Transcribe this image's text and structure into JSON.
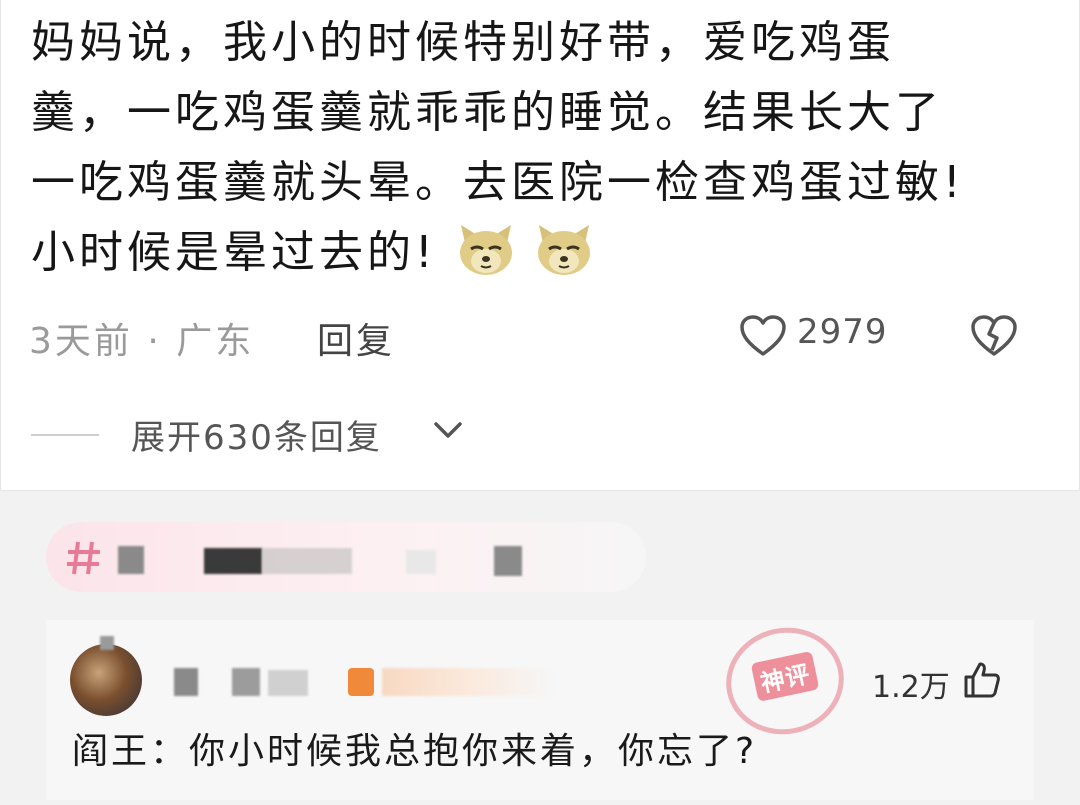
{
  "comment": {
    "lines": [
      "妈妈说，我小的时候特别好带，爱吃鸡蛋",
      "羹，一吃鸡蛋羹就乖乖的睡觉。结果长大了",
      "一吃鸡蛋羹就头晕。去医院一检查鸡蛋过敏!",
      "小时候是晕过去的!"
    ],
    "emoji": [
      "cat-face-emoji",
      "cat-face-emoji"
    ],
    "time_location": "3天前 · 广东",
    "reply_label": "回复",
    "like_count": "2979",
    "expand_label": "展开630条回复"
  },
  "reply": {
    "like_count": "1.2万",
    "stamp_text": "神评",
    "text": "阎王：你小时候我总抱你来着，你忘了?"
  },
  "colors": {
    "background": "#f2f2f2",
    "card": "#ffffff",
    "stamp": "#e86f7d",
    "tag_bg": "#fbe4ea"
  }
}
